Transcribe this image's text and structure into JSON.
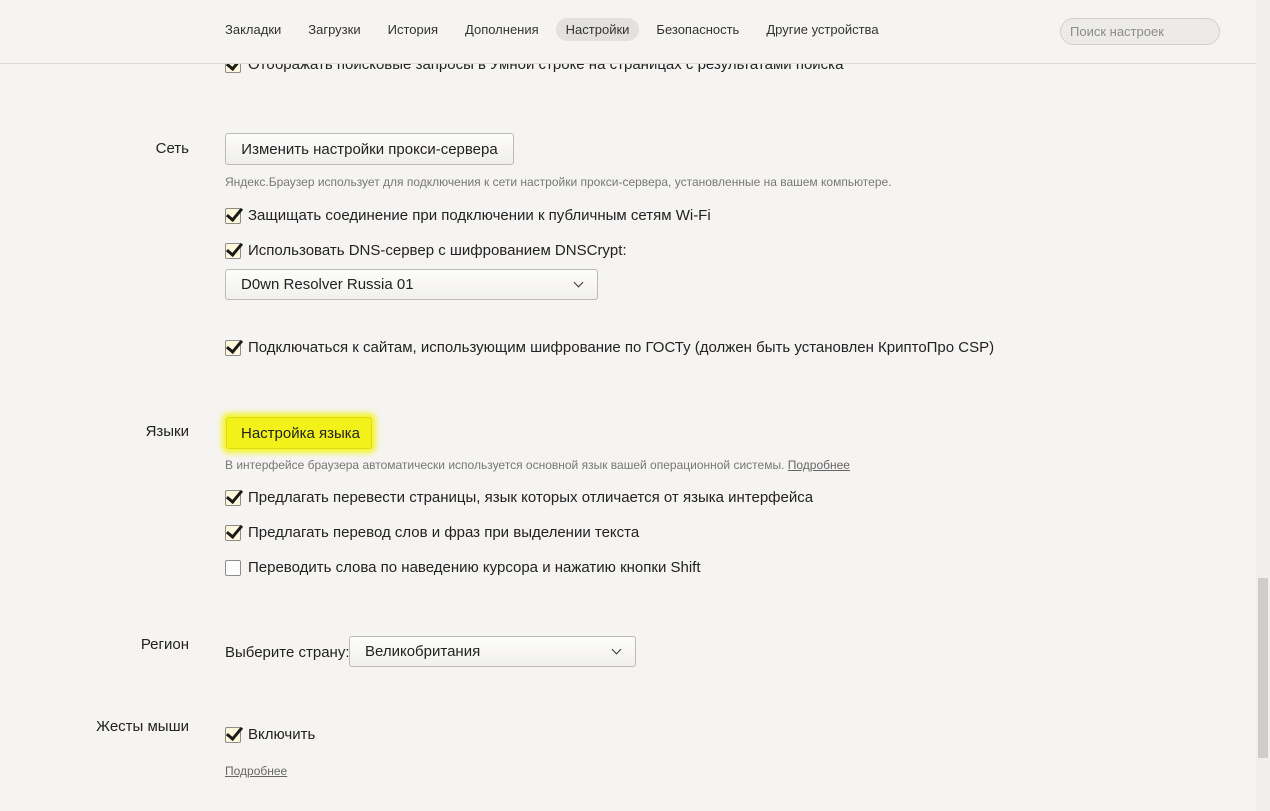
{
  "nav": {
    "tabs": [
      {
        "label": "Закладки"
      },
      {
        "label": "Загрузки"
      },
      {
        "label": "История"
      },
      {
        "label": "Дополнения"
      },
      {
        "label": "Настройки",
        "active": true
      },
      {
        "label": "Безопасность"
      },
      {
        "label": "Другие устройства"
      }
    ],
    "search_placeholder": "Поиск настроек"
  },
  "cut_row": {
    "label": "Отображать поисковые запросы в Умной строке на страницах с результатами поиска",
    "checked": true
  },
  "network": {
    "section_label": "Сеть",
    "proxy_button": "Изменить настройки прокси-сервера",
    "proxy_hint": "Яндекс.Браузер использует для подключения к сети настройки прокси-сервера, установленные на вашем компьютере.",
    "wifi_protect": {
      "label": "Защищать соединение при подключении к публичным сетям Wi-Fi",
      "checked": true
    },
    "dnscrypt": {
      "label": "Использовать DNS-сервер с шифрованием DNSCrypt:",
      "checked": true
    },
    "dns_select": "D0wn Resolver Russia 01",
    "gost": {
      "label": "Подключаться к сайтам, использующим шифрование по ГОСТу (должен быть установлен КриптоПро CSP)",
      "checked": true
    }
  },
  "languages": {
    "section_label": "Языки",
    "lang_button": "Настройка языка",
    "lang_hint": "В интерфейсе браузера автоматически используется основной язык вашей операционной системы.",
    "lang_hint_link": "Подробнее",
    "translate_pages": {
      "label": "Предлагать перевести страницы, язык которых отличается от языка интерфейса",
      "checked": true
    },
    "translate_words": {
      "label": "Предлагать перевод слов и фраз при выделении текста",
      "checked": true
    },
    "translate_hover": {
      "label": "Переводить слова по наведению курсора и нажатию кнопки Shift",
      "checked": false
    }
  },
  "region": {
    "section_label": "Регион",
    "country_label": "Выберите страну:",
    "country_select": "Великобритания"
  },
  "gestures": {
    "section_label": "Жесты мыши",
    "enable": {
      "label": "Включить",
      "checked": true
    },
    "more_link": "Подробнее"
  },
  "colors": {
    "background": "#f5f4f2",
    "highlight": "#f2f21a",
    "checkbox_checked_bg": "#fff8dc"
  }
}
